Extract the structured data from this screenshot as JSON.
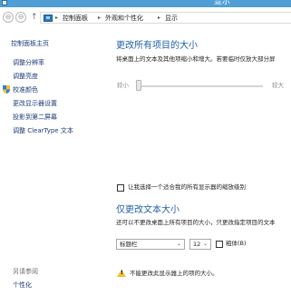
{
  "window": {
    "title": "显示"
  },
  "addressbar": {
    "back": "⊖",
    "forward": "⊖",
    "up": "↑",
    "crumbs": [
      "控制面板",
      "外观和个性化",
      "显示"
    ]
  },
  "sidebar": {
    "home": "控制面板主页",
    "items": [
      "调整分辨率",
      "调整亮度",
      "校准颜色",
      "更改显示器设置",
      "投影到第二屏幕",
      "调整 ClearType 文本"
    ],
    "see_also": "另请参阅",
    "see_also_items": [
      "个性化"
    ]
  },
  "main": {
    "section1": {
      "title": "更改所有项目的大小",
      "desc": "将桌面上的文本及其他项缩小和增大。若要临时仅放大部分屏",
      "slider_min": "较小",
      "slider_max": "较大"
    },
    "checkbox_label": "让我选择一个适合我的所有显示器的缩放级别",
    "section2": {
      "title": "仅更改文本大小",
      "desc": "还可以不更改桌面上所有项目的大小，只更改指定项目的文本",
      "item_select": "标题栏",
      "size_select": "12",
      "bold_label": "粗体(B)"
    },
    "warning": "不能更改此显示器上的项的大小。"
  },
  "colors": {
    "titlebar": "#4f9fd6",
    "heading": "#1f5fa8",
    "link": "#1e3a78"
  }
}
